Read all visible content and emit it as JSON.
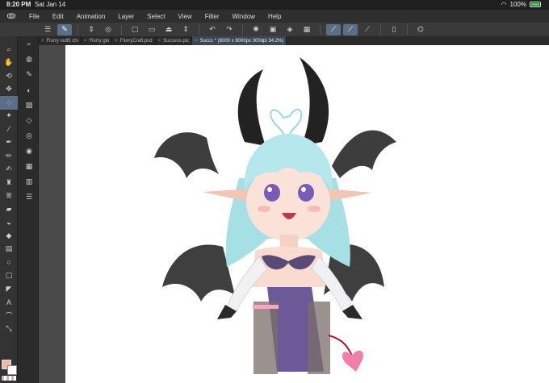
{
  "status": {
    "time": "8:20 PM",
    "date": "Sat Jan 14",
    "battery": "100%"
  },
  "menus": [
    "File",
    "Edit",
    "Animation",
    "Layer",
    "Select",
    "View",
    "Filter",
    "Window",
    "Help"
  ],
  "commands": [
    {
      "name": "menu-icon",
      "glyph": "☰"
    },
    {
      "name": "pen-settings-icon",
      "glyph": "✎",
      "active": true
    },
    {
      "name": "stepper-icon",
      "glyph": "⇕"
    },
    {
      "name": "eye-icon",
      "glyph": "◎"
    },
    {
      "name": "new-file-icon",
      "glyph": "▢"
    },
    {
      "name": "open-folder-icon",
      "glyph": "▭"
    },
    {
      "name": "save-icon",
      "glyph": "⏏"
    },
    {
      "name": "stepper-2-icon",
      "glyph": "⇕"
    },
    {
      "name": "undo-icon",
      "glyph": "↶"
    },
    {
      "name": "redo-icon",
      "glyph": "↷"
    },
    {
      "name": "sun-icon",
      "glyph": "✺"
    },
    {
      "name": "layer-icon",
      "glyph": "▣"
    },
    {
      "name": "fill-icon",
      "glyph": "◈"
    },
    {
      "name": "clear-icon",
      "glyph": "▦"
    },
    {
      "name": "ruler-icon",
      "glyph": "⟋",
      "active": true
    },
    {
      "name": "brush-ruler-icon",
      "glyph": "⟋",
      "active": true
    },
    {
      "name": "perspective-icon",
      "glyph": "⟋"
    },
    {
      "name": "device-icon",
      "glyph": "▯"
    },
    {
      "name": "assist-icon",
      "glyph": "⌬"
    }
  ],
  "tools": [
    {
      "name": "zoom-tool-icon",
      "glyph": "⌕"
    },
    {
      "name": "hand-tool-icon",
      "glyph": "✋"
    },
    {
      "name": "rotate-tool-icon",
      "glyph": "⟲"
    },
    {
      "name": "move-tool-icon",
      "glyph": "✥"
    },
    {
      "name": "lasso-tool-icon",
      "glyph": "◌",
      "active": true
    },
    {
      "name": "magic-wand-tool-icon",
      "glyph": "✦"
    },
    {
      "name": "eyedropper-tool-icon",
      "glyph": "⁄"
    },
    {
      "name": "pen-tool-icon",
      "glyph": "✒"
    },
    {
      "name": "pencil-tool-icon",
      "glyph": "✏"
    },
    {
      "name": "brush-tool-icon",
      "glyph": "✍"
    },
    {
      "name": "airbrush-tool-icon",
      "glyph": "♜"
    },
    {
      "name": "decoration-tool-icon",
      "glyph": "≣"
    },
    {
      "name": "eraser-tool-icon",
      "glyph": "▰"
    },
    {
      "name": "blend-tool-icon",
      "glyph": "◒"
    },
    {
      "name": "fill-tool-icon",
      "glyph": "◆"
    },
    {
      "name": "gradient-tool-icon",
      "glyph": "▤"
    },
    {
      "name": "figure-tool-icon",
      "glyph": "○"
    },
    {
      "name": "frame-tool-icon",
      "glyph": "▢"
    },
    {
      "name": "ruler-tool-icon",
      "glyph": "◤"
    },
    {
      "name": "text-tool-icon",
      "glyph": "A"
    },
    {
      "name": "balloon-tool-icon",
      "glyph": "⌒"
    },
    {
      "name": "correct-line-tool-icon",
      "glyph": "⤡"
    }
  ],
  "subtools": [
    {
      "name": "navigator-icon",
      "glyph": "⌕"
    },
    {
      "name": "layer-property-icon",
      "glyph": "◍"
    },
    {
      "name": "brush-size-icon",
      "glyph": "✎"
    },
    {
      "name": "color-set-icon",
      "glyph": "◐"
    },
    {
      "name": "image-icon",
      "glyph": "▨"
    },
    {
      "name": "layers-icon",
      "glyph": "◇"
    },
    {
      "name": "material-icon",
      "glyph": "◎"
    },
    {
      "name": "color-wheel-icon",
      "glyph": "◉"
    },
    {
      "name": "timeline-icon",
      "glyph": "▦"
    },
    {
      "name": "history-icon",
      "glyph": "▥"
    },
    {
      "name": "list-icon",
      "glyph": "☰"
    }
  ],
  "tabs": [
    {
      "label": "Flurry outfit chi",
      "active": false
    },
    {
      "label": "Flurry glo",
      "active": false
    },
    {
      "label": "FlurryCraft.psd",
      "active": false
    },
    {
      "label": "Success.pic",
      "active": false
    },
    {
      "label": "Succc * (8000 x 8000px 300dpi 34.2%)",
      "active": true
    }
  ],
  "colors": {
    "main": "#f5b8a8",
    "sub": "#ffffff",
    "accent": "#5a6e86"
  }
}
